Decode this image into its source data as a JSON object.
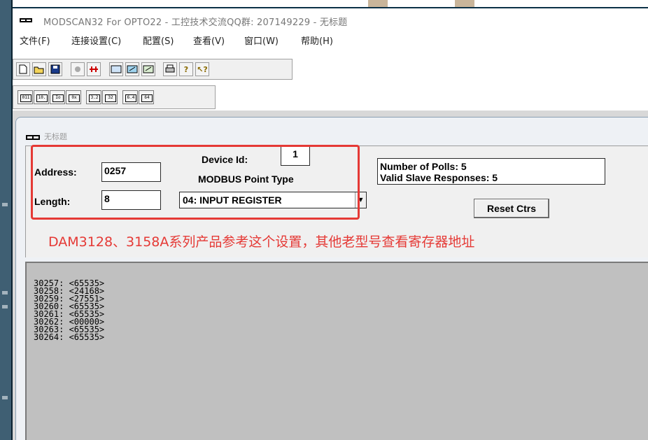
{
  "window": {
    "title": "MODSCAN32 For OPTO22 - 工控技术交流QQ群: 207149229 - 无标题"
  },
  "menu": [
    {
      "label": "文件(F)"
    },
    {
      "label": "连接设置(C)"
    },
    {
      "label": "配置(S)"
    },
    {
      "label": "查看(V)"
    },
    {
      "label": "窗口(W)"
    },
    {
      "label": "帮助(H)"
    }
  ],
  "toolbar1": [
    {
      "icon": "new-document-icon"
    },
    {
      "icon": "open-folder-icon"
    },
    {
      "icon": "save-disk-icon"
    },
    {
      "icon": "connect-icon"
    },
    {
      "icon": "disconnect-icon"
    },
    {
      "icon": "display-options-icon"
    },
    {
      "icon": "write-register-icon"
    },
    {
      "icon": "write-coil-icon"
    },
    {
      "icon": "print-icon"
    },
    {
      "icon": "help-icon"
    },
    {
      "icon": "context-help-icon"
    }
  ],
  "toolbar2": [
    {
      "label": "011"
    },
    {
      "label": "10."
    },
    {
      "label": "Io"
    },
    {
      "label": "0x"
    },
    {
      "label": "3.2"
    },
    {
      "label": "32"
    },
    {
      "label": "6.4"
    },
    {
      "label": "64"
    }
  ],
  "child_window": {
    "title": "无标题"
  },
  "form": {
    "address_label": "Address:",
    "address_value": "0257",
    "length_label": "Length:",
    "length_value": "8",
    "device_id_label": "Device Id:",
    "device_id_value": "1",
    "point_type_label": "MODBUS Point Type",
    "point_type_value": "04: INPUT REGISTER",
    "polls_label": "Number of Polls: 5",
    "valid_label": "Valid Slave Responses: 5",
    "reset_label": "Reset Ctrs"
  },
  "annotation": {
    "note": "DAM3128、3158A系列产品参考这个设置，其他老型号查看寄存器地址",
    "color": "#e53935"
  },
  "registers": [
    {
      "address": "30257",
      "value": "<65535>"
    },
    {
      "address": "30258",
      "value": "<24168>"
    },
    {
      "address": "30259",
      "value": "<27551>"
    },
    {
      "address": "30260",
      "value": "<65535>"
    },
    {
      "address": "30261",
      "value": "<65535>"
    },
    {
      "address": "30262",
      "value": "<00000>"
    },
    {
      "address": "30263",
      "value": "<65535>"
    },
    {
      "address": "30264",
      "value": "<65535>"
    }
  ]
}
